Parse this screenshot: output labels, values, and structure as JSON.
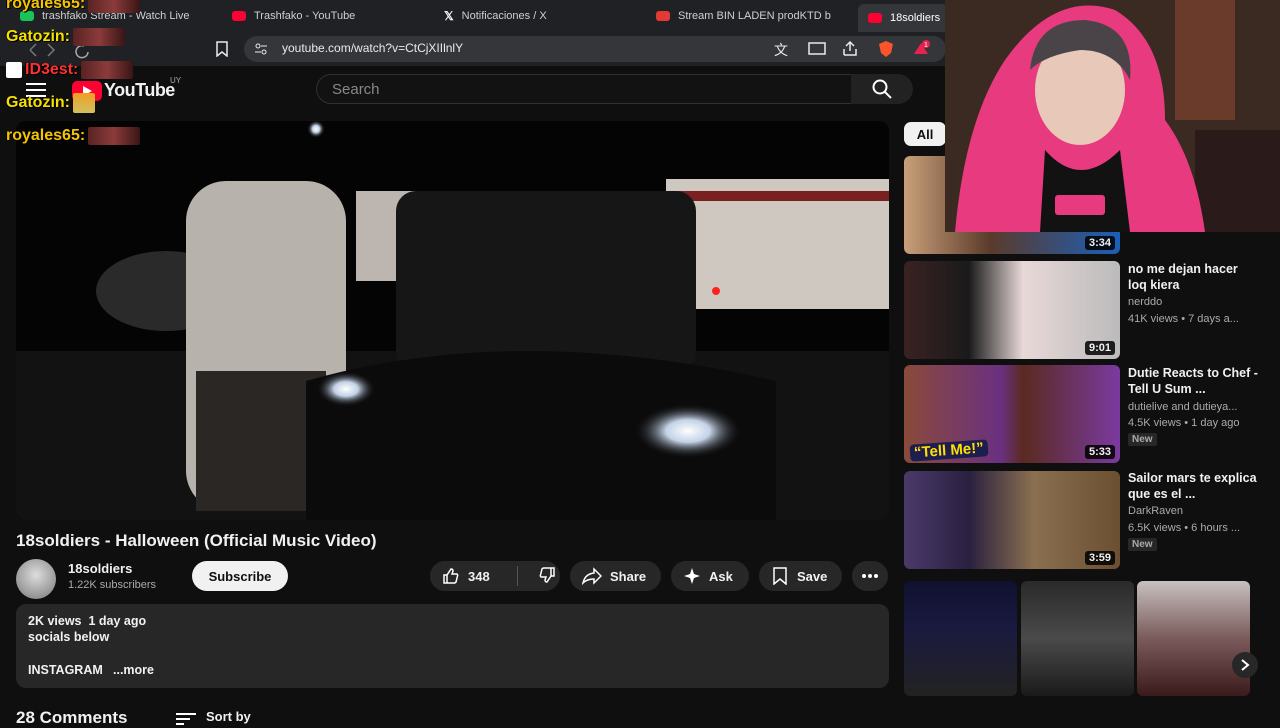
{
  "browser": {
    "tabs": [
      {
        "label": "trashfako Stream - Watch Live",
        "color": "#19c35a"
      },
      {
        "label": "Trashfako - YouTube",
        "color": "#ff0033"
      },
      {
        "label": "Notificaciones / X",
        "color": "#ffffff"
      },
      {
        "label": "Stream BIN LADEN prodKTD b",
        "color": "#e53935"
      },
      {
        "label": "18soldiers",
        "color": "#ff0033"
      }
    ],
    "url": "youtube.com/watch?v=CtCjXIIlnlY",
    "ext_badge": "1"
  },
  "chat": [
    {
      "user": "royales65:",
      "color": "#f5c400"
    },
    {
      "user": "Gatozin:",
      "color": "#f5e000"
    },
    {
      "user": "ID3est:",
      "color": "#ff3030"
    },
    {
      "user": "Gatozin:",
      "color": "#f5e000"
    },
    {
      "user": "royales65:",
      "color": "#f5c400"
    }
  ],
  "youtube": {
    "logo": "YouTube",
    "region": "UY",
    "search_placeholder": "Search",
    "chip_all": "All"
  },
  "video": {
    "title": "18soldiers - Halloween (Official Music Video)",
    "channel": "18soldiers",
    "subscribers": "1.22K subscribers",
    "subscribe_label": "Subscribe",
    "likes": "348",
    "share_label": "Share",
    "ask_label": "Ask",
    "save_label": "Save",
    "views_date": "2K views  1 day ago",
    "desc_line": "socials below",
    "desc_line2": "INSTAGRAM",
    "more_label": "...more",
    "comments_label": "28 Comments",
    "sort_label": "Sort by"
  },
  "related": [
    {
      "title": "",
      "channel": "",
      "meta": "",
      "duration": "3:34"
    },
    {
      "title": "no me dejan hacer loq kiera",
      "channel": "nerddo",
      "meta": "41K views • 7 days a...",
      "duration": "9:01"
    },
    {
      "title": "Dutie Reacts to Chef - Tell U Sum ...",
      "channel": "dutielive and dutieya...",
      "meta": "4.5K views • 1 day ago",
      "duration": "5:33",
      "badge": "New",
      "thumb_text": "“Tell Me!”"
    },
    {
      "title": "Sailor mars te explica que es el ...",
      "channel": "DarkRaven",
      "meta": "6.5K views • 6 hours ...",
      "duration": "3:59",
      "badge": "New"
    }
  ],
  "colors": {
    "bg": "#0f0f0f",
    "surface": "#272727",
    "accent": "#ff0033",
    "webcam_hoodie": "#e83a7e"
  },
  "icons": [
    "menu-icon",
    "search-icon",
    "like-icon",
    "dislike-icon",
    "share-icon",
    "sparkle-icon",
    "bookmark-icon",
    "more-icon",
    "chevron-right-icon",
    "translate-icon",
    "cast-icon",
    "share-page-icon",
    "brave-shield-icon"
  ]
}
